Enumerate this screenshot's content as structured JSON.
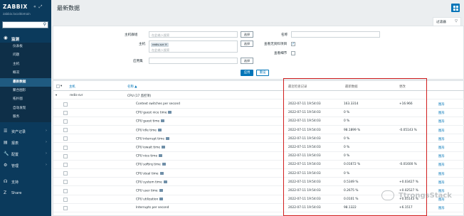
{
  "sidebar": {
    "logo": "ZABBIX",
    "subtitle": "zabbix.localdomain",
    "search_placeholder": "",
    "monitoring_label": "监测",
    "sub_items": [
      {
        "label": "仪表板",
        "active": false
      },
      {
        "label": "问题",
        "active": false
      },
      {
        "label": "主机",
        "active": false
      },
      {
        "label": "概况",
        "active": false
      },
      {
        "label": "最新数据",
        "active": true
      },
      {
        "label": "聚合图形",
        "active": false
      },
      {
        "label": "拓扑图",
        "active": false
      },
      {
        "label": "自动发现",
        "active": false
      },
      {
        "label": "服务",
        "active": false
      }
    ],
    "menu_items": [
      {
        "label": "资产记录",
        "icon": "list-icon"
      },
      {
        "label": "报表",
        "icon": "chart-icon"
      },
      {
        "label": "配置",
        "icon": "wrench-icon"
      },
      {
        "label": "管理",
        "icon": "gear-icon"
      },
      {
        "label": "支持",
        "icon": "headset-icon"
      },
      {
        "label": "Share",
        "icon": "share-icon"
      }
    ]
  },
  "header": {
    "title": "最新数据",
    "filter_tab": "过滤器"
  },
  "filter": {
    "host_group_label": "主机群组",
    "host_group_placeholder": "在此输入搜索",
    "host_label": "主机",
    "host_tag": "redis-svr",
    "host_placeholder": "在此输入搜索",
    "app_label": "应用集",
    "select_label": "选择",
    "name_label": "名称",
    "show_no_data_label": "查看无资料项目",
    "show_details_label": "查看细节",
    "apply_label": "应用",
    "reset_label": "重设"
  },
  "table": {
    "headers": {
      "host": "主机",
      "name": "名称 ▲",
      "last_check": "最近检查记录",
      "last_value": "最新数据",
      "change": "更改"
    },
    "host_row": "redis-svr",
    "group_row": "CPU (17 监控项)",
    "rows": [
      {
        "name": "Context switches per second",
        "tag": false,
        "time": "2022-07-11 19:54:03",
        "value": "163.3314",
        "change": "+16.966",
        "link": "图形"
      },
      {
        "name": "CPU guest nice time",
        "tag": true,
        "time": "2022-07-11 19:54:03",
        "value": "0 %",
        "change": "",
        "link": "图形"
      },
      {
        "name": "CPU guest time",
        "tag": true,
        "time": "2022-07-11 19:54:03",
        "value": "0 %",
        "change": "",
        "link": "图形"
      },
      {
        "name": "CPU idle time",
        "tag": true,
        "time": "2022-07-11 19:54:03",
        "value": "98.1899 %",
        "change": "-0.05143 %",
        "link": "图形"
      },
      {
        "name": "CPU interrupt time",
        "tag": true,
        "time": "2022-07-11 19:54:03",
        "value": "0 %",
        "change": "",
        "link": "图形"
      },
      {
        "name": "CPU iowait time",
        "tag": true,
        "time": "2022-07-11 19:54:03",
        "value": "0 %",
        "change": "",
        "link": "图形"
      },
      {
        "name": "CPU nice time",
        "tag": true,
        "time": "2022-07-11 19:54:03",
        "value": "0 %",
        "change": "",
        "link": "图形"
      },
      {
        "name": "CPU softirq time",
        "tag": true,
        "time": "2022-07-11 19:54:03",
        "value": "0.01672 %",
        "change": "-0.01600 %",
        "link": "图形"
      },
      {
        "name": "CPU steal time",
        "tag": true,
        "time": "2022-07-11 19:54:03",
        "value": "0 %",
        "change": "",
        "link": "图形"
      },
      {
        "name": "CPU system time",
        "tag": true,
        "time": "2022-07-11 19:54:03",
        "value": "0.5349 %",
        "change": "+0.03427 %",
        "link": "图形"
      },
      {
        "name": "CPU user time",
        "tag": true,
        "time": "2022-07-11 19:54:03",
        "value": "0.2675 %",
        "change": "+0.02527 %",
        "link": "图形"
      },
      {
        "name": "CPU utilization",
        "tag": true,
        "time": "2022-07-11 19:54:03",
        "value": "0.0101 %",
        "change": "+0.05143 %",
        "link": "图形"
      },
      {
        "name": "Interrupts per second",
        "tag": false,
        "time": "2022-07-11 19:54:03",
        "value": "98.1322",
        "change": "+6.1517",
        "link": "图形"
      }
    ]
  },
  "watermark": "TtrongsStack",
  "colors": {
    "sidebar": "#0b3a5c",
    "accent": "#0275b8",
    "highlight_box": "#d11e1e"
  }
}
